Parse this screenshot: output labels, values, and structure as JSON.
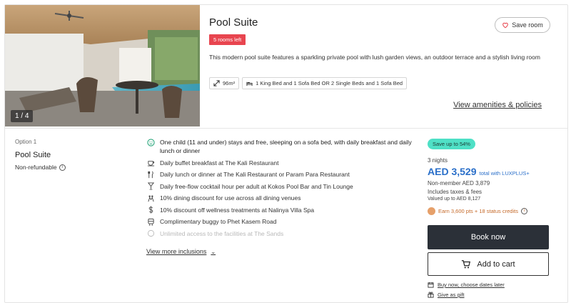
{
  "room": {
    "title": "Pool Suite",
    "rooms_left": "5 rooms left",
    "save_label": "Save room",
    "description": "This modern pool suite features a sparkling private pool with lush garden views, an outdoor terrace and a stylish living room",
    "size": "96m²",
    "beds": "1 King Bed and 1 Sofa Bed OR 2 Single Beds and 1 Sofa Bed",
    "view_amenities": "View amenities & policies",
    "photo_counter": "1 / 4"
  },
  "option": {
    "label": "Option 1",
    "title": "Pool Suite",
    "refund": "Non-refundable"
  },
  "inclusions": [
    {
      "icon": "child-icon",
      "text": "One child (11 and under) stays and free, sleeping on a sofa bed, with daily breakfast and daily lunch or dinner"
    },
    {
      "icon": "breakfast-icon",
      "text": "Daily buffet breakfast at The Kali Restaurant"
    },
    {
      "icon": "cutlery-icon",
      "text": "Daily lunch or dinner at The Kali Restaurant or Param Para Restaurant"
    },
    {
      "icon": "cocktail-icon",
      "text": "Daily free-flow cocktail hour per adult at Kokos Pool Bar and Tin Lounge"
    },
    {
      "icon": "dining-icon",
      "text": "10% dining discount for use across all dining venues"
    },
    {
      "icon": "dollar-icon",
      "text": "10% discount off wellness treatments at Nalinya Villa Spa"
    },
    {
      "icon": "buggy-icon",
      "text": "Complimentary buggy to Phet Kasem Road"
    },
    {
      "icon": "facility-icon",
      "text": "Unlimited access to the facilities at The Sands"
    }
  ],
  "view_more": "View more inclusions",
  "pricing": {
    "save_badge": "Save up to 54%",
    "nights": "3 nights",
    "price": "AED 3,529",
    "price_note": "total with LUXPLUS+",
    "nonmember": "Non-member AED 3,879",
    "taxes": "Includes taxes & fees",
    "valued": "Valued up to AED 8,127",
    "points": "Earn 3,600 pts + 18 status credits"
  },
  "actions": {
    "book_now": "Book now",
    "add_to_cart": "Add to cart",
    "buy_now": "Buy now, choose dates later",
    "gift": "Give as gift"
  },
  "colors": {
    "rooms_left_bg": "#e8454f",
    "save_badge_bg": "#4fe0c6",
    "price_blue": "#2a6fc9",
    "book_now_bg": "#2b3038",
    "points_orange": "#c56a2a"
  }
}
